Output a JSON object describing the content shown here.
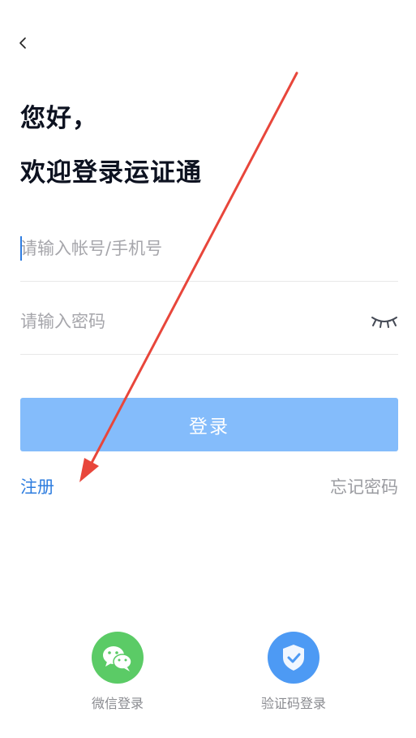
{
  "header": {
    "back_icon": "chevron-left-icon"
  },
  "greeting": {
    "line1": "您好，",
    "line2": "欢迎登录运证通"
  },
  "form": {
    "account_placeholder": "请输入帐号/手机号",
    "account_value": "",
    "password_placeholder": "请输入密码",
    "password_value": "",
    "password_toggle_icon": "eye-closed-icon",
    "login_label": "登录",
    "register_label": "注册",
    "forgot_label": "忘记密码"
  },
  "alt_login": [
    {
      "label": "微信登录",
      "icon": "wechat-icon",
      "color": "#5bcb66"
    },
    {
      "label": "验证码登录",
      "icon": "shield-check-icon",
      "color": "#4d9af4"
    }
  ],
  "colors": {
    "accent": "#2e7ddf",
    "login_button": "#84bcfb",
    "annotation_arrow": "#e8463b"
  }
}
